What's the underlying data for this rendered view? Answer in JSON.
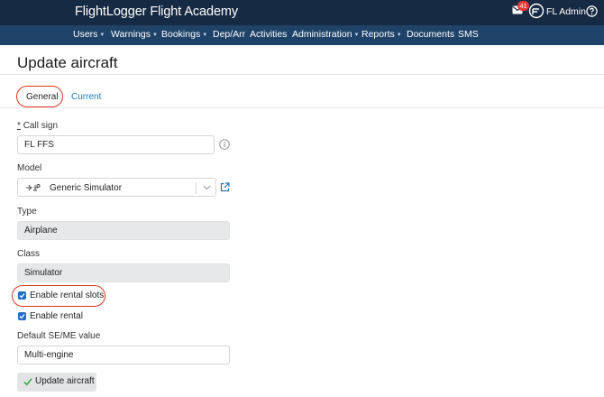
{
  "header": {
    "brand": "FlightLogger Flight Academy",
    "notification_count": "41",
    "user_name": "FL Admin"
  },
  "nav": {
    "items": [
      {
        "label": "Users",
        "dropdown": true
      },
      {
        "label": "Warnings",
        "dropdown": true
      },
      {
        "label": "Bookings",
        "dropdown": true
      },
      {
        "label": "Dep/Arr",
        "dropdown": false
      },
      {
        "label": "Activities",
        "dropdown": false
      },
      {
        "label": "Administration",
        "dropdown": true
      },
      {
        "label": "Reports",
        "dropdown": true
      },
      {
        "label": "Documents",
        "dropdown": false
      },
      {
        "label": "SMS",
        "dropdown": false
      }
    ]
  },
  "page": {
    "title": "Update aircraft"
  },
  "tabs": {
    "general": "General",
    "current": "Current"
  },
  "form": {
    "call_sign": {
      "required_mark": "*",
      "label": "Call sign",
      "value": "FL FFS"
    },
    "model": {
      "label": "Model",
      "value": "Generic Simulator"
    },
    "type": {
      "label": "Type",
      "value": "Airplane"
    },
    "class": {
      "label": "Class",
      "value": "Simulator"
    },
    "enable_rental_slots": {
      "label": "Enable rental slots",
      "checked": true
    },
    "enable_rental": {
      "label": "Enable rental",
      "checked": true
    },
    "default_seme": {
      "label": "Default SE/ME value",
      "value": "Multi-engine"
    },
    "submit_label": "Update aircraft"
  },
  "colors": {
    "topbar": "#172a43",
    "navbar": "#1f4268",
    "link": "#1f7ab8",
    "checkbox": "#1f6fd1",
    "highlight_circle": "#d9381e",
    "badge": "#e53935"
  },
  "icons": [
    "envelope-icon",
    "flightlogger-logo",
    "help-icon",
    "info-icon",
    "simulator-icon",
    "chevron-down-icon",
    "external-link-icon",
    "checkmark-icon"
  ]
}
